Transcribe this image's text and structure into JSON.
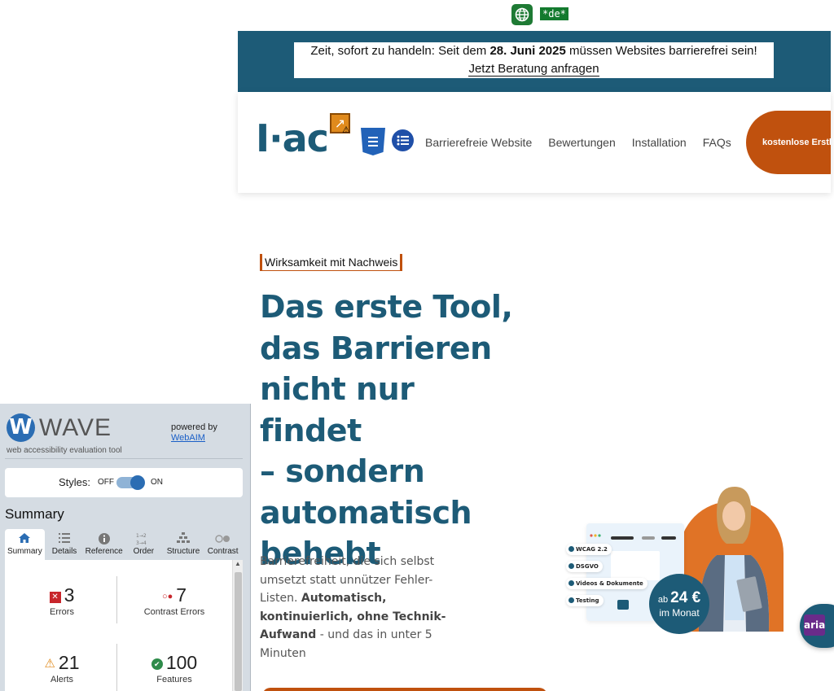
{
  "lang_bar": {
    "globe_icon": "globe-icon",
    "lang_tag": "*de*"
  },
  "banner": {
    "text_prefix": "Zeit, sofort zu handeln: Seit dem ",
    "date": "28. Juni 2025",
    "text_suffix": " müssen Websites barrierefrei sein!",
    "link": "Jetzt Beratung anfragen"
  },
  "header": {
    "logo": "I·ac",
    "nav": [
      "Barrierefreie Website",
      "Bewertungen",
      "Installation",
      "FAQs"
    ],
    "cta": "kostenlose Erstb"
  },
  "hero": {
    "eyebrow": "Wirksamkeit mit Nachweis",
    "title_lines": [
      "Das erste Tool,",
      "das Barrieren",
      "nicht nur findet",
      "– sondern",
      "automatisch",
      "behebt"
    ],
    "text_plain_1": "Barrierefreiheit, die sich selbst umsetzt statt unnützer Fehler-Listen. ",
    "text_bold": "Automatisch, kontinuierlich, ohne Technik-Aufwand",
    "text_plain_2": " - und das in unter 5 Minuten"
  },
  "illustration": {
    "chips": [
      "WCAG 2.2",
      "DSGVO",
      "Videos & Dokumente",
      "Testing"
    ],
    "price_prefix": "ab ",
    "price": "24 €",
    "price_sub": "im Monat",
    "aria_label": "aria"
  },
  "wave": {
    "logo_letter": "W",
    "name": "WAVE",
    "tagline": "web accessibility evaluation tool",
    "powered_by": "powered by",
    "powered_link": "WebAIM",
    "styles_label": "Styles:",
    "styles_off": "OFF",
    "styles_on": "ON",
    "summary_heading": "Summary",
    "tabs": [
      {
        "label": "Summary",
        "icon": "home-icon"
      },
      {
        "label": "Details",
        "icon": "list-icon"
      },
      {
        "label": "Reference",
        "icon": "info-icon"
      },
      {
        "label": "Order",
        "icon": "order-icon"
      },
      {
        "label": "Structure",
        "icon": "structure-icon"
      },
      {
        "label": "Contrast",
        "icon": "contrast-icon"
      }
    ],
    "stats": {
      "errors": {
        "count": "3",
        "label": "Errors"
      },
      "contrast": {
        "count": "7",
        "label": "Contrast Errors"
      },
      "alerts": {
        "count": "21",
        "label": "Alerts"
      },
      "features": {
        "count": "100",
        "label": "Features"
      }
    }
  },
  "colors": {
    "brand_blue": "#1d5b77",
    "brand_orange": "#c0510e",
    "wave_blue": "#2b6db3",
    "error_red": "#c8262c",
    "alert_orange": "#e08a1c",
    "feature_green": "#2e8b4a"
  }
}
